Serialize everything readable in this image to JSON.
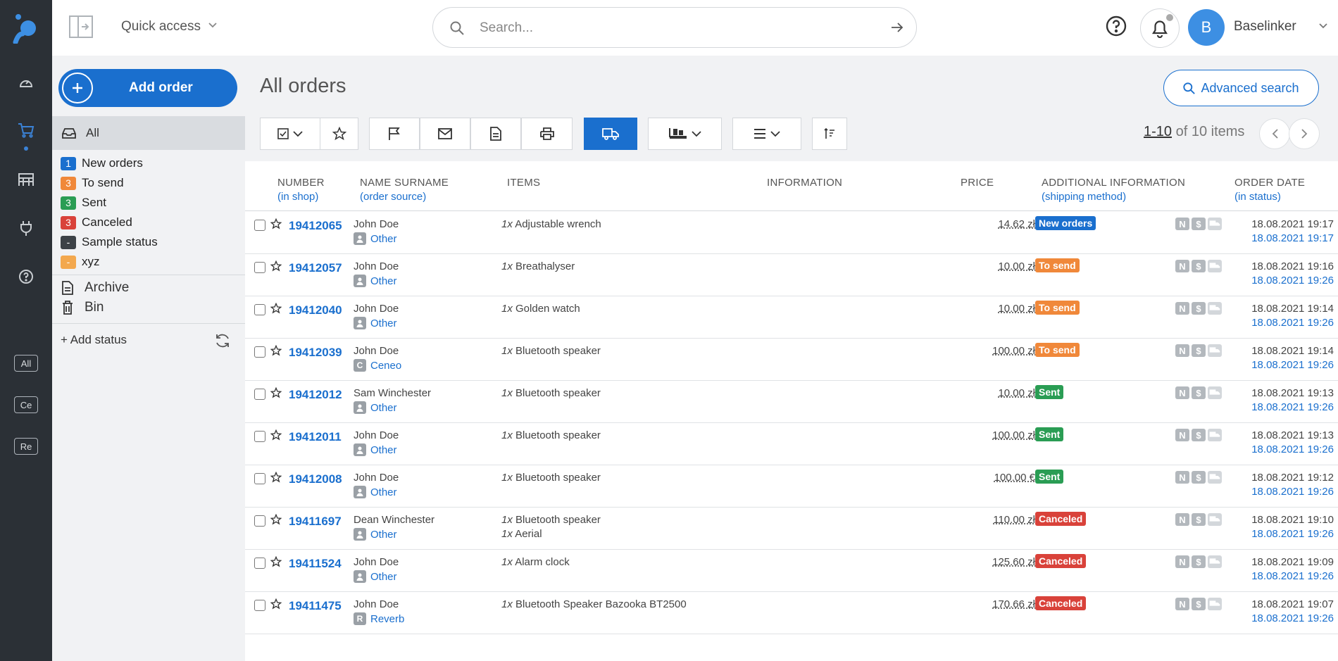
{
  "quick_access": {
    "label": "Quick access"
  },
  "search": {
    "placeholder": "Search..."
  },
  "user": {
    "initial": "B",
    "name": "Baselinker"
  },
  "rail": {
    "chips": [
      "All",
      "Ce",
      "Re"
    ]
  },
  "add_order": {
    "label": "Add order"
  },
  "statuses": {
    "all": "All",
    "items": [
      {
        "badge": "1",
        "label": "New orders",
        "color": "#1a6fce"
      },
      {
        "badge": "3",
        "label": "To send",
        "color": "#f0883a"
      },
      {
        "badge": "3",
        "label": "Sent",
        "color": "#2a9d54"
      },
      {
        "badge": "3",
        "label": "Canceled",
        "color": "#d9423a"
      },
      {
        "badge": "-",
        "label": "Sample status",
        "color": "#3d4247"
      },
      {
        "badge": "-",
        "label": "xyz",
        "color": "#f3a84e"
      }
    ],
    "archive": "Archive",
    "bin": "Bin",
    "add_status": "+ Add status"
  },
  "page": {
    "title": "All orders",
    "advanced_search": "Advanced search"
  },
  "pager": {
    "range": "1-10",
    "rest": "of 10 items"
  },
  "columns": {
    "number": "NUMBER",
    "number_sub": "(in shop)",
    "name": "NAME SURNAME",
    "name_sub": "(order source)",
    "items": "ITEMS",
    "information": "INFORMATION",
    "price": "PRICE",
    "additional": "ADDITIONAL INFORMATION",
    "additional_sub": "(shipping method)",
    "date": "ORDER DATE",
    "date_sub": "(in status)"
  },
  "orders": [
    {
      "number": "19412065",
      "name": "John Doe",
      "source_icon": "person",
      "source": "Other",
      "items": [
        [
          "1x",
          "Adjustable wrench"
        ]
      ],
      "price": "14.62 zł",
      "status": "New orders",
      "status_color": "#1a6fce",
      "date": "18.08.2021 19:17",
      "status_date": "18.08.2021 19:17"
    },
    {
      "number": "19412057",
      "name": "John Doe",
      "source_icon": "person",
      "source": "Other",
      "items": [
        [
          "1x",
          "Breathalyser"
        ]
      ],
      "price": "10.00 zł",
      "status": "To send",
      "status_color": "#f0883a",
      "date": "18.08.2021 19:16",
      "status_date": "18.08.2021 19:26"
    },
    {
      "number": "19412040",
      "name": "John Doe",
      "source_icon": "person",
      "source": "Other",
      "items": [
        [
          "1x",
          "Golden watch"
        ]
      ],
      "price": "10.00 zł",
      "status": "To send",
      "status_color": "#f0883a",
      "date": "18.08.2021 19:14",
      "status_date": "18.08.2021 19:26"
    },
    {
      "number": "19412039",
      "name": "John Doe",
      "source_icon": "C",
      "source": "Ceneo",
      "items": [
        [
          "1x",
          "Bluetooth speaker"
        ]
      ],
      "price": "100.00 zł",
      "status": "To send",
      "status_color": "#f0883a",
      "date": "18.08.2021 19:14",
      "status_date": "18.08.2021 19:26"
    },
    {
      "number": "19412012",
      "name": "Sam Winchester",
      "source_icon": "person",
      "source": "Other",
      "items": [
        [
          "1x",
          "Bluetooth speaker"
        ]
      ],
      "price": "10.00 zł",
      "status": "Sent",
      "status_color": "#2a9d54",
      "date": "18.08.2021 19:13",
      "status_date": "18.08.2021 19:26"
    },
    {
      "number": "19412011",
      "name": "John Doe",
      "source_icon": "person",
      "source": "Other",
      "items": [
        [
          "1x",
          "Bluetooth speaker"
        ]
      ],
      "price": "100.00 zł",
      "status": "Sent",
      "status_color": "#2a9d54",
      "date": "18.08.2021 19:13",
      "status_date": "18.08.2021 19:26"
    },
    {
      "number": "19412008",
      "name": "John Doe",
      "source_icon": "person",
      "source": "Other",
      "items": [
        [
          "1x",
          "Bluetooth speaker"
        ]
      ],
      "price": "100.00 €",
      "status": "Sent",
      "status_color": "#2a9d54",
      "date": "18.08.2021 19:12",
      "status_date": "18.08.2021 19:26"
    },
    {
      "number": "19411697",
      "name": "Dean Winchester",
      "source_icon": "person",
      "source": "Other",
      "items": [
        [
          "1x",
          "Bluetooth speaker"
        ],
        [
          "1x",
          "Aerial"
        ]
      ],
      "price": "110.00 zł",
      "status": "Canceled",
      "status_color": "#d9423a",
      "date": "18.08.2021 19:10",
      "status_date": "18.08.2021 19:26"
    },
    {
      "number": "19411524",
      "name": "John Doe",
      "source_icon": "person",
      "source": "Other",
      "items": [
        [
          "1x",
          "Alarm clock"
        ]
      ],
      "price": "125.60 zł",
      "status": "Canceled",
      "status_color": "#d9423a",
      "date": "18.08.2021 19:09",
      "status_date": "18.08.2021 19:26"
    },
    {
      "number": "19411475",
      "name": "John Doe",
      "source_icon": "R",
      "source": "Reverb",
      "items": [
        [
          "1x",
          "Bluetooth Speaker Bazooka BT2500"
        ]
      ],
      "price": "170.66 zł",
      "status": "Canceled",
      "status_color": "#d9423a",
      "date": "18.08.2021 19:07",
      "status_date": "18.08.2021 19:26"
    }
  ],
  "mini_icons": [
    "N",
    "$"
  ]
}
